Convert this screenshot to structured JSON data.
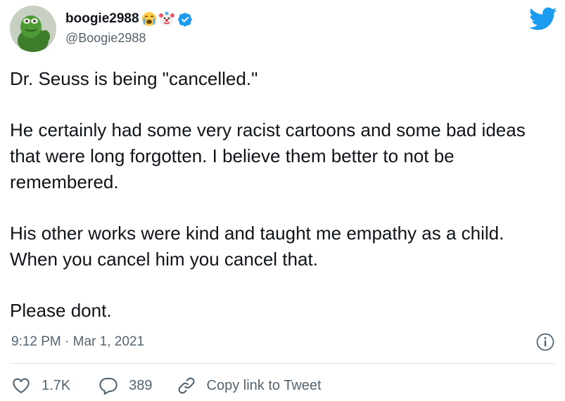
{
  "tweet": {
    "display_name": "boogie2988",
    "name_emojis": [
      "crying-face-emoji",
      "clown-face-emoji"
    ],
    "handle": "@Boogie2988",
    "verified": true,
    "paragraphs": [
      "Dr. Seuss is being \"cancelled.\"",
      "He certainly had some very racist cartoons and some bad ideas that were long forgotten.  I believe them better to not be remembered.",
      "His other works were kind and taught me empathy as a child. When you cancel him you cancel that.",
      "Please dont."
    ],
    "timestamp": "9:12 PM · Mar 1, 2021"
  },
  "actions": {
    "likes": "1.7K",
    "replies": "389",
    "copy_link": "Copy link to Tweet"
  },
  "colors": {
    "twitter_blue": "#1d9bf0",
    "text": "#0f1419",
    "secondary_text": "#536471",
    "divider": "#e1e8ed"
  }
}
